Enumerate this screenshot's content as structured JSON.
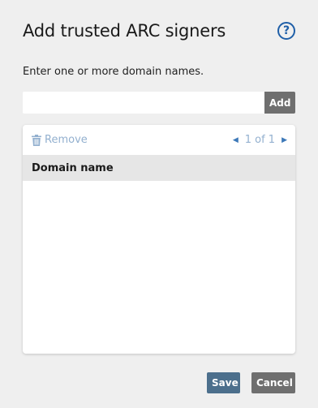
{
  "dialog": {
    "title": "Add trusted ARC signers",
    "help_icon": "question-circle-icon",
    "help_glyph": "?"
  },
  "instructions": "Enter one or more domain names.",
  "domain_input": {
    "value": "",
    "placeholder": ""
  },
  "add_label": "Add",
  "list": {
    "remove_label": "Remove",
    "remove_icon": "trash-icon",
    "pagination": "1 of 1",
    "prev_icon": "caret-left-icon",
    "next_icon": "caret-right-icon",
    "column_header": "Domain name",
    "rows": []
  },
  "footer": {
    "save_label": "Save",
    "cancel_label": "Cancel"
  },
  "colors": {
    "accent": "#1f5fa8",
    "save": "#4c6f8c",
    "neutral_button": "#6f6f6f",
    "disabled_text": "#93b0cf"
  }
}
